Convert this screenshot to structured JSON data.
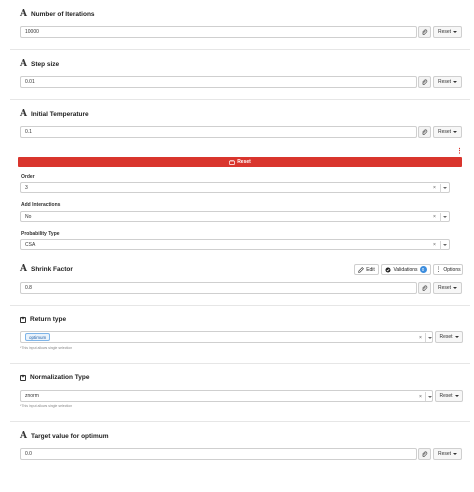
{
  "fields": {
    "iterations": {
      "title": "Number of Iterations",
      "value": "10000",
      "reset_label": "Reset"
    },
    "step_size": {
      "title": "Step size",
      "value": "0.01",
      "reset_label": "Reset"
    },
    "initial_temp": {
      "title": "Initial Temperature",
      "value": "0.1",
      "reset_label": "Reset"
    },
    "shrink_factor": {
      "title": "Shrink Factor",
      "value": "0.8",
      "reset_label": "Reset"
    },
    "target_value": {
      "title": "Target value for optimum",
      "value": "0.0",
      "reset_label": "Reset"
    }
  },
  "reset_bar": {
    "label": "Reset"
  },
  "order": {
    "label": "Order",
    "value": "3"
  },
  "add_interactions": {
    "label": "Add Interactions",
    "value": "No"
  },
  "probability_type": {
    "label": "Probability Type",
    "value": "CSA"
  },
  "shrink_toolbar": {
    "edit_label": "Edit",
    "validations_label": "Validations",
    "validations_count": "0",
    "options_label": "Options"
  },
  "return_type": {
    "title": "Return type",
    "tag": "optimum",
    "help": "*This input allows single selection",
    "reset_label": "Reset"
  },
  "normalization_type": {
    "title": "Normalization Type",
    "value": "znorm",
    "help": "*This input allows single selection",
    "reset_label": "Reset"
  },
  "icons": {
    "field_type": "letter-a-icon",
    "attachment": "paperclip-icon",
    "dropdown": "caret-down-icon",
    "clear": "close-icon",
    "edit": "pencil-icon",
    "validations": "check-circle-icon",
    "options": "vertical-dots-icon",
    "checkbox": "checkbox-icon",
    "reset": "reset-icon"
  },
  "colors": {
    "danger": "#d9352d",
    "badge": "#3c8dde",
    "tag": "#1e5ea6"
  }
}
